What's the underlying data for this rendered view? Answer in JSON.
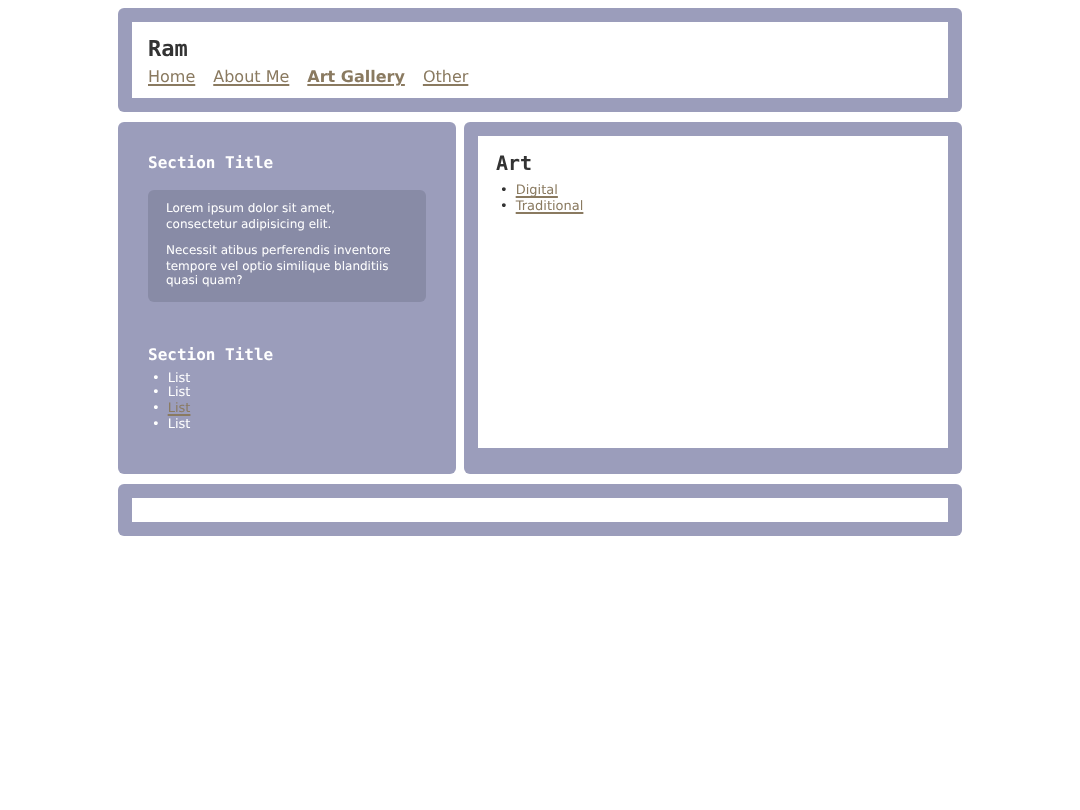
{
  "header": {
    "title": "Ram",
    "nav": [
      {
        "label": "Home",
        "selected": false
      },
      {
        "label": "About Me",
        "selected": false
      },
      {
        "label": "Art Gallery",
        "selected": true
      },
      {
        "label": "Other",
        "selected": false
      }
    ]
  },
  "sidebar": {
    "sections": [
      {
        "title": "Section Title",
        "paragraphs": [
          "Lorem ipsum dolor sit amet, consectetur adipisicing elit.",
          "Necessit atibus perferendis inventore tempore vel optio similique blanditiis quasi quam?"
        ]
      },
      {
        "title": "Section Title",
        "items": [
          {
            "marker": "•",
            "label": "List",
            "kind": "text"
          },
          {
            "marker": "•",
            "label": "List",
            "kind": "text"
          },
          {
            "marker": "•",
            "label": "List",
            "kind": "link"
          },
          {
            "marker": "•",
            "label": "List",
            "kind": "text"
          }
        ]
      }
    ]
  },
  "main": {
    "title": "Art",
    "links": [
      {
        "marker": "•",
        "label": "Digital"
      },
      {
        "marker": "•",
        "label": "Traditional"
      }
    ]
  }
}
